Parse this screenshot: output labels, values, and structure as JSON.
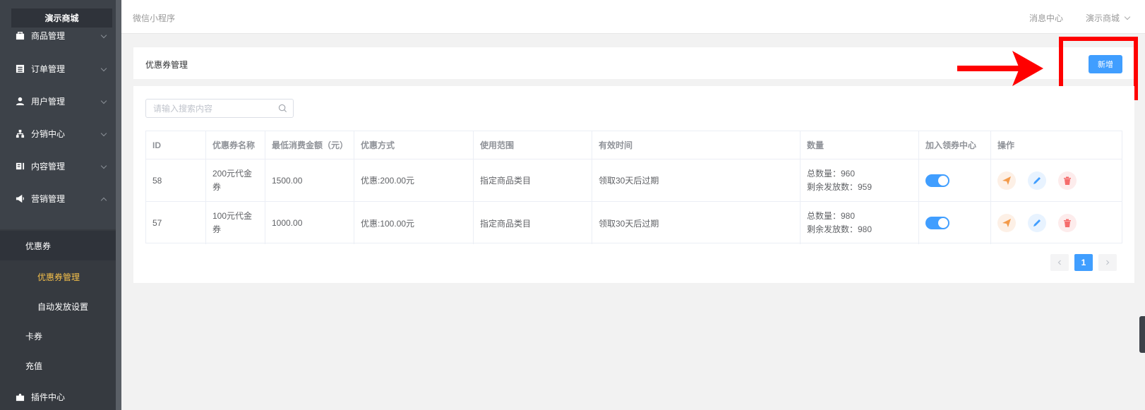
{
  "sidebar": {
    "brand": "演示商城",
    "items": [
      {
        "label": "商品管理",
        "icon": "bag-icon"
      },
      {
        "label": "订单管理",
        "icon": "order-icon"
      },
      {
        "label": "用户管理",
        "icon": "user-icon"
      },
      {
        "label": "分销中心",
        "icon": "network-icon"
      },
      {
        "label": "内容管理",
        "icon": "content-icon"
      },
      {
        "label": "营销管理",
        "icon": "marketing-icon"
      }
    ],
    "submenu": {
      "coupon_group": "优惠券",
      "coupon_manage": "优惠券管理",
      "auto_send": "自动发放设置",
      "card": "卡券",
      "recharge": "充值"
    },
    "plugin": "插件中心"
  },
  "header": {
    "app_name": "微信小程序",
    "message_center": "消息中心",
    "shop_name": "演示商城"
  },
  "page": {
    "title": "优惠券管理",
    "add_button": "新增"
  },
  "search": {
    "placeholder": "请输入搜索内容"
  },
  "table": {
    "columns": [
      "ID",
      "优惠券名称",
      "最低消费金额（元）",
      "优惠方式",
      "使用范围",
      "有效时间",
      "数量",
      "加入领券中心",
      "操作"
    ],
    "rows": [
      {
        "id": "58",
        "name_line1": "200元代金",
        "name_line2": "券",
        "min_amount": "1500.00",
        "discount": "优惠:200.00元",
        "scope": "指定商品类目",
        "validity": "领取30天后过期",
        "total": "总数量：960",
        "remain": "剩余发放数：959",
        "in_center": true
      },
      {
        "id": "57",
        "name_line1": "100元代金",
        "name_line2": "券",
        "min_amount": "1000.00",
        "discount": "优惠:100.00元",
        "scope": "指定商品类目",
        "validity": "领取30天后过期",
        "total": "总数量：980",
        "remain": "剩余发放数：980",
        "in_center": true
      }
    ]
  },
  "pagination": {
    "current": "1"
  },
  "colors": {
    "primary": "#409eff",
    "sidebar_bg": "#3d4249",
    "active_menu": "#f5c04a",
    "annotation": "#ff0000"
  }
}
